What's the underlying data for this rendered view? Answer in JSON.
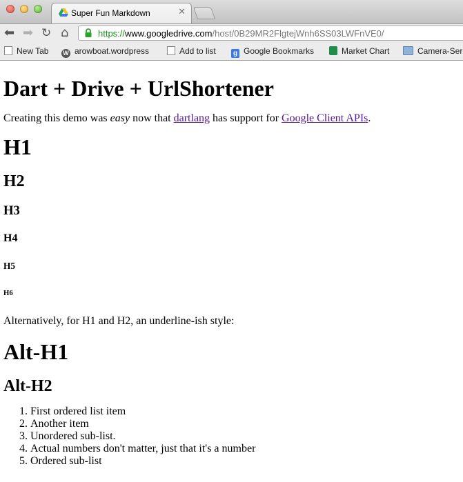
{
  "browser": {
    "tab": {
      "title": "Super Fun Markdown"
    },
    "address": {
      "scheme": "https://",
      "domain": "www.googledrive.com",
      "path": "/host/0B29MR2FlgtejWnh6SS03LWFnVE0/"
    },
    "bookmarks": [
      {
        "label": "New Tab",
        "icon": "page-icon"
      },
      {
        "label": "arowboat.wordpress",
        "icon": "wordpress-icon"
      },
      {
        "label": "Add to list",
        "icon": "page-icon"
      },
      {
        "label": "Google Bookmarks",
        "icon": "google-icon"
      },
      {
        "label": "Market Chart",
        "icon": "chart-icon"
      },
      {
        "label": "Camera-Ser",
        "icon": "folder-icon"
      }
    ]
  },
  "page": {
    "title": "Dart + Drive + UrlShortener",
    "intro": {
      "before": "Creating this demo was ",
      "emph": "easy",
      "middle": " now that ",
      "link1": "dartlang",
      "middle2": " has support for ",
      "link2": "Google Client APIs",
      "after": "."
    },
    "h1": "H1",
    "h2": "H2",
    "h3": "H3",
    "h4": "H4",
    "h5": "H5",
    "h6": "H6",
    "alt_note": "Alternatively, for H1 and H2, an underline-ish style:",
    "alt_h1": "Alt-H1",
    "alt_h2": "Alt-H2",
    "list": [
      "First ordered list item",
      "Another item",
      "Unordered sub-list.",
      "Actual numbers don't matter, just that it's a number",
      "Ordered sub-list"
    ]
  }
}
